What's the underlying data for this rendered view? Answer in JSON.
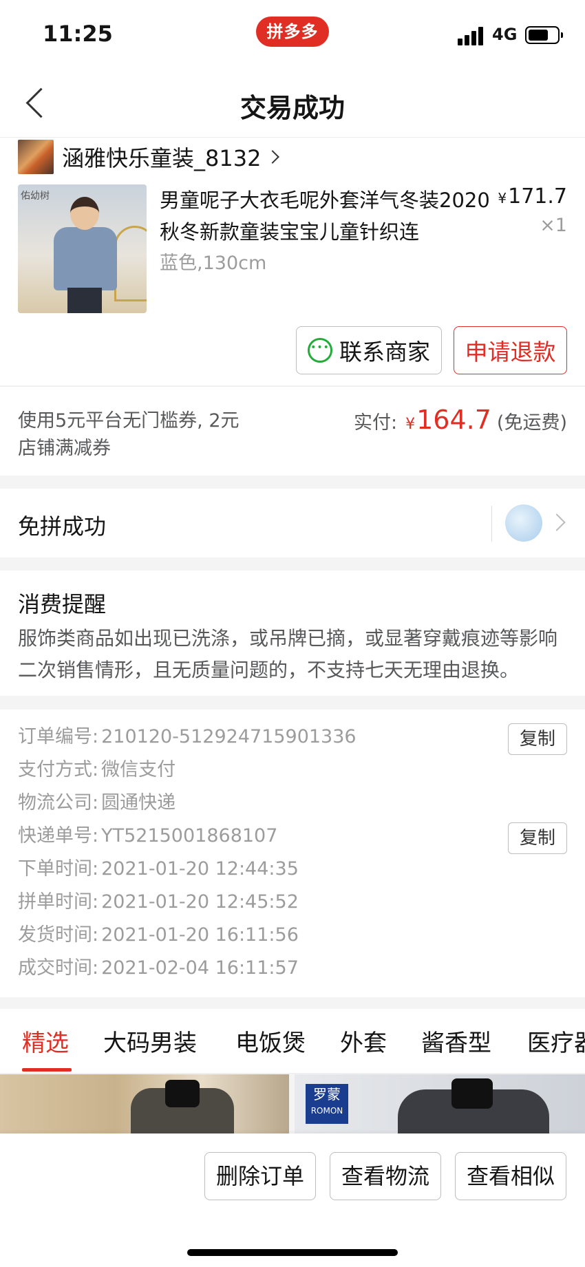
{
  "status_bar": {
    "time": "11:25",
    "app_badge": "拼多多",
    "network": "4G"
  },
  "nav": {
    "title": "交易成功"
  },
  "order": {
    "shop_name": "涵雅快乐童装_8132",
    "thumb_brand": "佑幼树",
    "product_title": "男童呢子大衣毛呢外套洋气冬装2020秋冬新款童装宝宝儿童针织连",
    "sku": "蓝色,130cm",
    "currency": "¥",
    "price": "171.7",
    "quantity": "×1",
    "contact_button": "联系商家",
    "refund_button": "申请退款"
  },
  "payment": {
    "coupon_text": "使用5元平台无门槛券, 2元店铺满减券",
    "paid_label": "实付:",
    "currency": "¥",
    "paid_amount": "164.7",
    "shipping_note": "(免运费)"
  },
  "group": {
    "label": "免拼成功"
  },
  "reminder": {
    "title": "消费提醒",
    "text": "服饰类商品如出现已洗涤，或吊牌已摘，或显著穿戴痕迹等影响二次销售情形，且无质量问题的，不支持七天无理由退换。"
  },
  "details": {
    "copy_label": "复制",
    "rows": [
      {
        "label": "订单编号:",
        "value": "210120-512924715901336"
      },
      {
        "label": "支付方式:",
        "value": "微信支付"
      },
      {
        "label": "物流公司:",
        "value": "圆通快递"
      },
      {
        "label": "快递单号:",
        "value": "YT5215001868107"
      },
      {
        "label": "下单时间:",
        "value": "2021-01-20 12:44:35"
      },
      {
        "label": "拼单时间:",
        "value": "2021-01-20 12:45:52"
      },
      {
        "label": "发货时间:",
        "value": "2021-01-20 16:11:56"
      },
      {
        "label": "成交时间:",
        "value": "2021-02-04 16:11:57"
      }
    ]
  },
  "tabs": [
    "精选",
    "大码男装",
    "电饭煲",
    "外套",
    "酱香型",
    "医疗器"
  ],
  "promo": {
    "brand_cn": "罗蒙",
    "brand_en": "ROMON"
  },
  "actions": {
    "delete": "删除订单",
    "logistics": "查看物流",
    "similar": "查看相似"
  },
  "colors": {
    "accent": "#e02e24",
    "wechat_green": "#22ac38",
    "muted_text": "#9c9c9c"
  }
}
